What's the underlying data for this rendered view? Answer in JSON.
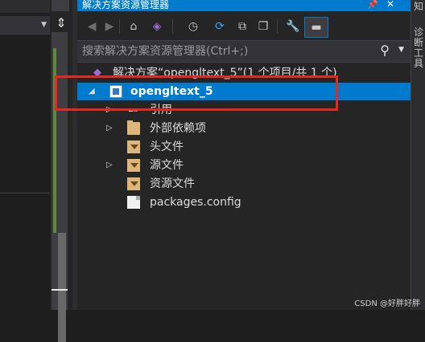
{
  "left": {
    "split_icon": "split-vertical-icon"
  },
  "solution_explorer": {
    "title": "解决方案资源管理器",
    "pin_icon": "pin-icon",
    "close_glyph": "✕",
    "toolbar": [
      {
        "name": "back-icon",
        "glyph": "◀",
        "style": "dim"
      },
      {
        "name": "forward-icon",
        "glyph": "▶",
        "style": "dim"
      },
      {
        "name": "home-icon",
        "glyph": "⌂",
        "style": ""
      },
      {
        "name": "vs-solution-switch-icon",
        "glyph": "◈",
        "style": "purple"
      },
      {
        "name": "pending-changes-icon",
        "glyph": "◷",
        "style": ""
      },
      {
        "name": "sync-icon",
        "glyph": "⟳",
        "style": "blue"
      },
      {
        "name": "collapse-all-icon",
        "glyph": "⧉",
        "style": ""
      },
      {
        "name": "show-all-files-icon",
        "glyph": "❐",
        "style": ""
      },
      {
        "name": "properties-icon",
        "glyph": "🔧",
        "style": ""
      },
      {
        "name": "preview-icon",
        "glyph": "▬",
        "style": "active"
      }
    ],
    "search_placeholder": "搜索解决方案资源管理器(Ctrl+;)",
    "search_icon": "search-icon",
    "tree": [
      {
        "label": "解决方案“opengltext_5”(1 个项目/共 1 个)",
        "level": 0,
        "icon": "vs-icon",
        "twisty": ""
      },
      {
        "label": "opengltext_5",
        "level": 1,
        "icon": "project-icon",
        "twisty": "◢",
        "selected": true
      },
      {
        "label": "引用",
        "level": 2,
        "icon": "references-icon",
        "twisty": "▷"
      },
      {
        "label": "外部依赖项",
        "level": 2,
        "icon": "folder-icon",
        "twisty": "▷"
      },
      {
        "label": "头文件",
        "level": 2,
        "icon": "filter-icon",
        "twisty": ""
      },
      {
        "label": "源文件",
        "level": 2,
        "icon": "filter-icon",
        "twisty": "▷"
      },
      {
        "label": "资源文件",
        "level": 2,
        "icon": "filter-icon",
        "twisty": ""
      },
      {
        "label": "packages.config",
        "level": 2,
        "icon": "file-icon",
        "twisty": ""
      }
    ]
  },
  "right_strip": {
    "label": "诊断工具"
  },
  "watermark": "CSDN @好胖好胖",
  "colors": {
    "accent": "#007acc",
    "highlight": "#e8271e"
  }
}
